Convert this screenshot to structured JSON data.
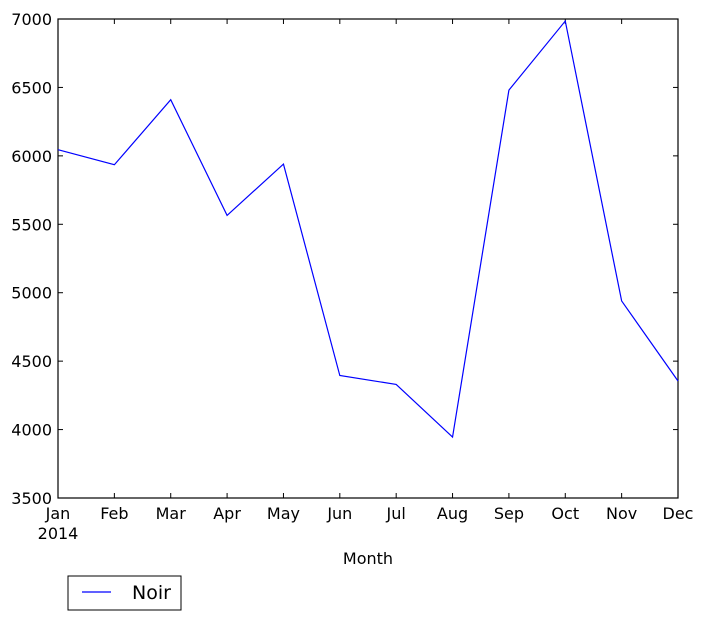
{
  "chart_data": {
    "type": "line",
    "title": "",
    "xlabel": "Month",
    "ylabel": "",
    "categories": [
      "Jan",
      "Feb",
      "Mar",
      "Apr",
      "May",
      "Jun",
      "Jul",
      "Aug",
      "Sep",
      "Oct",
      "Nov",
      "Dec"
    ],
    "x_sublabel": "2014",
    "ylim": [
      3500,
      7000
    ],
    "yticks": [
      3500,
      4000,
      4500,
      5000,
      5500,
      6000,
      6500,
      7000
    ],
    "grid": false,
    "legend_position": "below-left",
    "series": [
      {
        "name": "Noir",
        "color": "#0000ff",
        "values": [
          6045,
          5935,
          6410,
          5565,
          5940,
          4395,
          4330,
          3945,
          6480,
          6985,
          4940,
          4355
        ]
      }
    ]
  }
}
